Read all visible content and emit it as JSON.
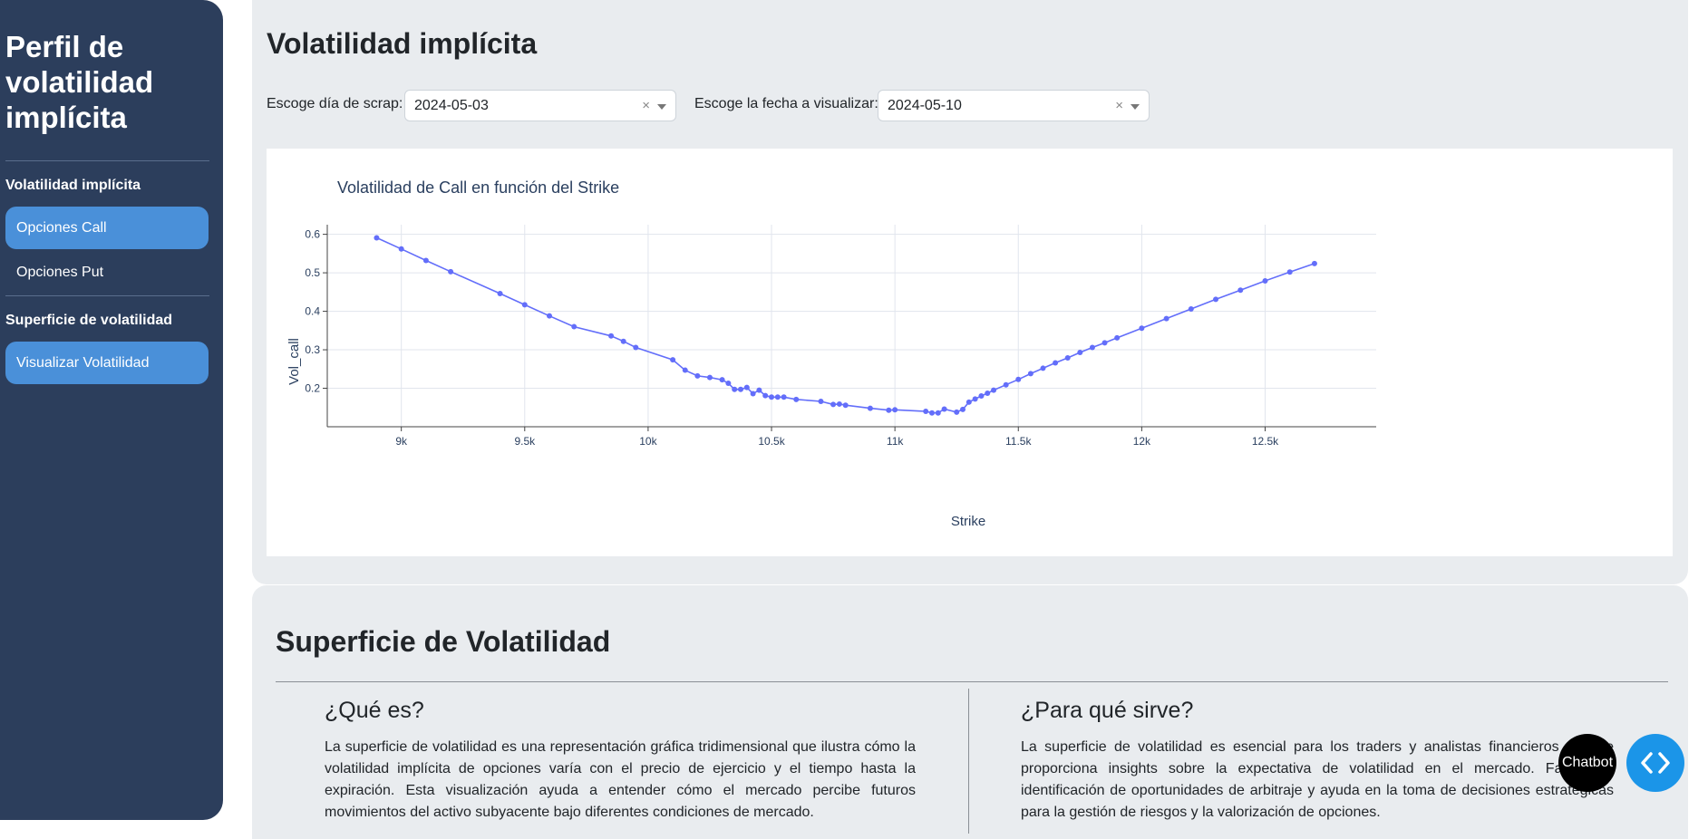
{
  "sidebar": {
    "title": "Perfil de volatilidad implícita",
    "section1": "Volatilidad implícita",
    "items1": [
      {
        "label": "Opciones Call"
      },
      {
        "label": "Opciones Put"
      }
    ],
    "section2": "Superficie de volatilidad",
    "items2": [
      {
        "label": "Visualizar Volatilidad"
      }
    ]
  },
  "main": {
    "title": "Volatilidad implícita",
    "scrap_label": "Escoge día de scrap:",
    "scrap_value": "2024-05-03",
    "date_label": "Escoge la fecha a visualizar:",
    "date_value": "2024-05-10",
    "clear_symbol": "×"
  },
  "chart_data": {
    "type": "line",
    "title": "Volatilidad de Call en función del Strike",
    "xlabel": "Strike",
    "ylabel": "Vol_call",
    "xlim": [
      8700,
      12950
    ],
    "ylim": [
      0.1,
      0.625
    ],
    "xticks": [
      {
        "v": 9000,
        "label": "9k"
      },
      {
        "v": 9500,
        "label": "9.5k"
      },
      {
        "v": 10000,
        "label": "10k"
      },
      {
        "v": 10500,
        "label": "10.5k"
      },
      {
        "v": 11000,
        "label": "11k"
      },
      {
        "v": 11500,
        "label": "11.5k"
      },
      {
        "v": 12000,
        "label": "12k"
      },
      {
        "v": 12500,
        "label": "12.5k"
      }
    ],
    "yticks": [
      {
        "v": 0.2,
        "label": "0.2"
      },
      {
        "v": 0.3,
        "label": "0.3"
      },
      {
        "v": 0.4,
        "label": "0.4"
      },
      {
        "v": 0.5,
        "label": "0.5"
      },
      {
        "v": 0.6,
        "label": "0.6"
      }
    ],
    "color": "#636efa",
    "x": [
      8900,
      9000,
      9100,
      9200,
      9400,
      9500,
      9600,
      9700,
      9850,
      9900,
      9950,
      10100,
      10150,
      10200,
      10250,
      10300,
      10325,
      10350,
      10375,
      10400,
      10425,
      10450,
      10475,
      10500,
      10525,
      10550,
      10600,
      10700,
      10750,
      10775,
      10800,
      10900,
      10975,
      11000,
      11125,
      11150,
      11175,
      11200,
      11250,
      11275,
      11300,
      11325,
      11350,
      11375,
      11400,
      11450,
      11500,
      11550,
      11600,
      11650,
      11700,
      11750,
      11800,
      11850,
      11900,
      12000,
      12100,
      12200,
      12300,
      12400,
      12500,
      12600,
      12700
    ],
    "values": [
      0.591,
      0.562,
      0.532,
      0.503,
      0.446,
      0.417,
      0.388,
      0.36,
      0.336,
      0.322,
      0.306,
      0.274,
      0.247,
      0.232,
      0.228,
      0.222,
      0.213,
      0.197,
      0.197,
      0.202,
      0.186,
      0.195,
      0.181,
      0.177,
      0.177,
      0.177,
      0.171,
      0.166,
      0.158,
      0.159,
      0.156,
      0.148,
      0.143,
      0.144,
      0.14,
      0.136,
      0.136,
      0.146,
      0.138,
      0.145,
      0.164,
      0.172,
      0.18,
      0.187,
      0.195,
      0.209,
      0.223,
      0.238,
      0.252,
      0.266,
      0.279,
      0.293,
      0.306,
      0.318,
      0.331,
      0.356,
      0.381,
      0.406,
      0.431,
      0.455,
      0.479,
      0.502,
      0.524
    ]
  },
  "surface": {
    "title": "Superficie de Volatilidad",
    "col1_title": "¿Qué es?",
    "col1_text": "La superficie de volatilidad es una representación gráfica tridimensional que ilustra cómo la volatilidad implícita de opciones varía con el precio de ejercicio y el tiempo hasta la expiración. Esta visualización ayuda a entender cómo el mercado percibe futuros movimientos del activo subyacente bajo diferentes condiciones de mercado.",
    "col2_title": "¿Para qué sirve?",
    "col2_text": "La superficie de volatilidad es esencial para los traders y analistas financieros ya que proporciona insights sobre la expectativa de volatilidad en el mercado. Facilita la identificación de oportunidades de arbitraje y ayuda en la toma de decisiones estratégicas para la gestión de riesgos y la valorización de opciones."
  },
  "floating": {
    "chatbot_label": "Chatbot",
    "code_icon": "code-icon"
  }
}
